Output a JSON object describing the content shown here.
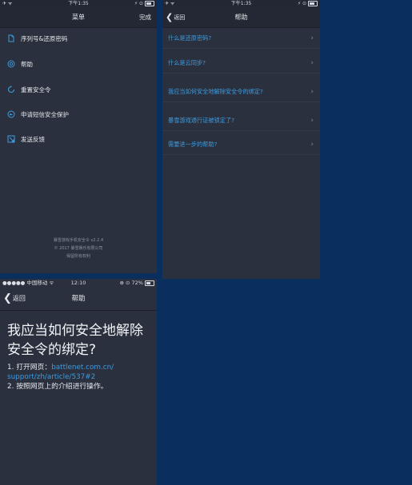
{
  "menu_screen": {
    "status": {
      "left": "✈ ᯤ",
      "time": "下午1:35",
      "right": "⚡ ⊙"
    },
    "title": "菜单",
    "done_label": "完成",
    "items": [
      {
        "label": "序列号&还原密码",
        "icon": "document-icon"
      },
      {
        "label": "帮助",
        "icon": "help-icon"
      },
      {
        "label": "重置安全令",
        "icon": "reset-icon"
      },
      {
        "label": "申请短信安全保护",
        "icon": "sms-protect-icon"
      },
      {
        "label": "发送反馈",
        "icon": "feedback-icon"
      }
    ],
    "footer": {
      "app": "暴雪游戏手机安全令 v2.2.4",
      "copyright": "© 2017 暴雪娱乐有限公司",
      "rights": "保留所有权利"
    }
  },
  "help_screen": {
    "status": {
      "left": "✈ ᯤ",
      "time": "下午1:35",
      "right": "⚡ ⊙"
    },
    "back_label": "返回",
    "title": "帮助",
    "questions": [
      "什么是还原密码?",
      "什么是云同步?",
      "我应当如何安全地解除安全令的绑定?",
      "暴雪游戏通行证被锁定了?",
      "需要进一步的帮助?"
    ]
  },
  "article_screen": {
    "status": {
      "carrier": "●●●●● 中国移动 ᯤ",
      "time": "12:10",
      "right": "⊕ ⊙ 72%"
    },
    "back_label": "返回",
    "title": "帮助",
    "heading": "我应当如何安全地解除安全令的绑定?",
    "step1_prefix": "1. 打开网页：",
    "step1_link_a": "battlenet.com.cn/",
    "step1_link_b": "support/zh/article/537#2",
    "step2": "2. 按照网页上的介绍进行操作。"
  },
  "colors": {
    "background": "#0a2f5e",
    "panel": "#2a303d",
    "link": "#3d9be0"
  }
}
